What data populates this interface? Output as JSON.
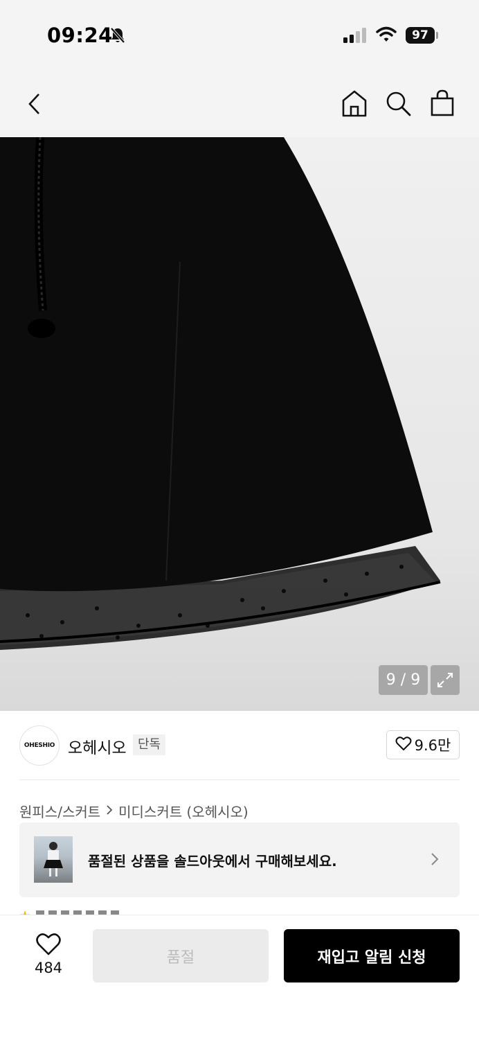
{
  "status_bar": {
    "time": "09:24",
    "battery": "97"
  },
  "nav": {
    "icons": [
      "back-icon",
      "home-icon",
      "search-icon",
      "shopping-bag-icon"
    ]
  },
  "gallery": {
    "counter": "9 / 9"
  },
  "brand": {
    "logo_text": "OHESHIO",
    "name": "오헤시오",
    "badge": "단독",
    "like_count": "9.6만"
  },
  "breadcrumb": {
    "category": "원피스/스커트",
    "subcategory": "미디스커트 (오헤시오)"
  },
  "soldout_banner": {
    "text": "품절된 상품을 솔드아웃에서 구매해보세요."
  },
  "bottom_bar": {
    "wish_count": "484",
    "soldout_label": "품절",
    "restock_label": "재입고 알림 신청"
  },
  "colors": {
    "accent": "#000000",
    "disabled_bg": "#ebebeb",
    "disabled_text": "#bcbcbc",
    "surface": "#f4f4f4"
  }
}
